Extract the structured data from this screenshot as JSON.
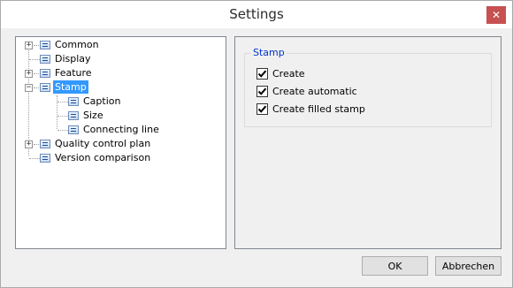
{
  "window": {
    "title": "Settings",
    "close_glyph": "✕"
  },
  "tree": {
    "items": [
      {
        "label": "Common",
        "icon": "list-icon",
        "expandable": true,
        "expander": "+"
      },
      {
        "label": "Display",
        "icon": "list-icon",
        "expandable": false
      },
      {
        "label": "Feature",
        "icon": "list-icon",
        "expandable": true,
        "expander": "+"
      },
      {
        "label": "Stamp",
        "icon": "list-icon",
        "expandable": true,
        "expander": "−",
        "selected": true
      },
      {
        "label": "Caption",
        "icon": "list-icon",
        "child": true
      },
      {
        "label": "Size",
        "icon": "list-icon",
        "child": true
      },
      {
        "label": "Connecting line",
        "icon": "list-icon",
        "child": true
      },
      {
        "label": "Quality control plan",
        "icon": "list-icon",
        "expandable": true,
        "expander": "+"
      },
      {
        "label": "Version comparison",
        "icon": "list-icon",
        "expandable": false
      }
    ]
  },
  "stamp_group": {
    "title": "Stamp",
    "options": [
      {
        "label": "Create",
        "checked": true
      },
      {
        "label": "Create automatic",
        "checked": true
      },
      {
        "label": "Create filled stamp",
        "checked": true
      }
    ]
  },
  "buttons": {
    "ok": "OK",
    "cancel": "Abbrechen"
  },
  "colors": {
    "selection": "#3399ff",
    "group_title": "#0033cc",
    "close_button": "#c75050"
  }
}
